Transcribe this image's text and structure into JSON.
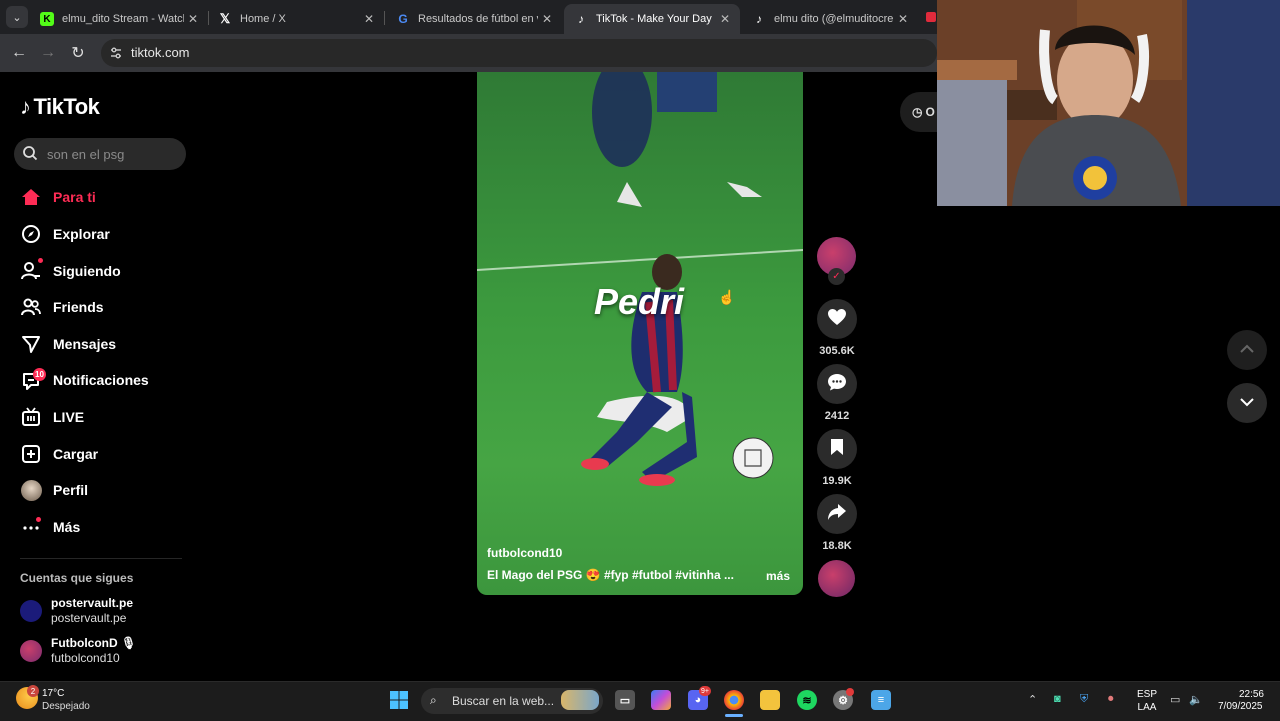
{
  "browser": {
    "tabs": [
      {
        "title": "elmu_dito Stream - Watch",
        "favicon": "kick-icon",
        "active": false
      },
      {
        "title": "Home / X",
        "favicon": "x-icon",
        "active": false
      },
      {
        "title": "Resultados de fútbol en vi",
        "favicon": "google-icon",
        "active": false
      },
      {
        "title": "TikTok - Make Your Day",
        "favicon": "tiktok-icon",
        "active": true
      },
      {
        "title": "elmu dito (@elmuditocre",
        "favicon": "tiktok-icon",
        "active": false
      }
    ],
    "url": "tiktok.com"
  },
  "tiktok": {
    "brand": "TikTok",
    "search_placeholder": "son en el psg",
    "nav": [
      {
        "label": "Para ti",
        "icon": "home-icon",
        "active": true
      },
      {
        "label": "Explorar",
        "icon": "compass-icon"
      },
      {
        "label": "Siguiendo",
        "icon": "following-icon"
      },
      {
        "label": "Friends",
        "icon": "friends-icon"
      },
      {
        "label": "Mensajes",
        "icon": "messages-icon"
      },
      {
        "label": "Notificaciones",
        "icon": "notifications-icon",
        "badge": "10"
      },
      {
        "label": "LIVE",
        "icon": "live-icon"
      },
      {
        "label": "Cargar",
        "icon": "upload-icon"
      },
      {
        "label": "Perfil",
        "icon": "profile-icon"
      },
      {
        "label": "Más",
        "icon": "more-icon"
      }
    ],
    "following_heading": "Cuentas que sigues",
    "following": [
      {
        "name": "postervault.pe",
        "handle": "postervault.pe"
      },
      {
        "name": "FutbolconD 🎙",
        "handle": "futbolcond10"
      }
    ],
    "video": {
      "overlay_text": "Pedri",
      "author": "futbolcond10",
      "caption": "El Mago del PSG 😍 #fyp  #futbol  #vitinha  ...",
      "more": "más"
    },
    "actions": {
      "likes": "305.6K",
      "comments": "2412",
      "saves": "19.9K",
      "shares": "18.8K"
    },
    "pill_label": "O"
  },
  "taskbar": {
    "weather_badge": "2",
    "temperature": "17°C",
    "condition": "Despejado",
    "search_placeholder": "Buscar en la web...",
    "discord_badge": "9+",
    "lang_top": "ESP",
    "lang_bottom": "LAA",
    "time": "22:56",
    "date": "7/09/2025"
  }
}
